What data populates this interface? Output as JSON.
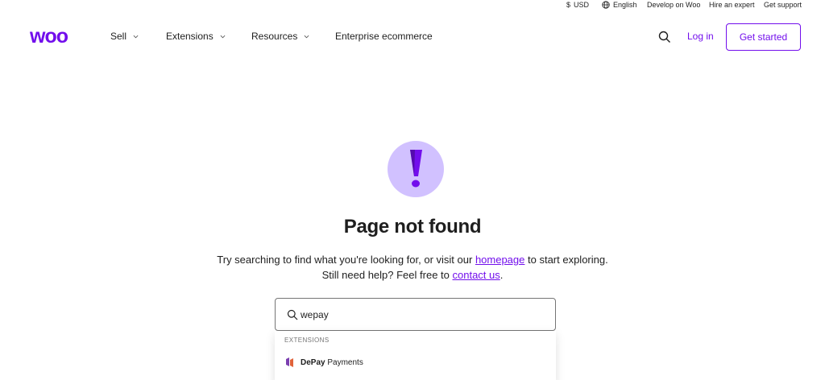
{
  "utility": {
    "currency": "USD",
    "language": "English",
    "develop": "Develop on Woo",
    "hire": "Hire an expert",
    "support": "Get support"
  },
  "header": {
    "logo_text": "woo",
    "nav": {
      "sell": "Sell",
      "extensions": "Extensions",
      "resources": "Resources",
      "enterprise": "Enterprise ecommerce"
    },
    "login": "Log in",
    "get_started": "Get started"
  },
  "content": {
    "title": "Page not found",
    "message_before": "Try searching to find what you're looking for, or visit our ",
    "homepage_link": "homepage",
    "message_middle": " to start exploring. Still need help? Feel free to ",
    "contact_link": "contact us",
    "message_end": "."
  },
  "search": {
    "value": "wepay"
  },
  "dropdown": {
    "section_label": "EXTENSIONS",
    "result_bold": "DePay",
    "result_rest": " Payments"
  },
  "colors": {
    "brand": "#720eec",
    "alert_bg": "#d1c1ff",
    "alert_fg": "#720eec"
  },
  "icons": {
    "currency": "dollar-icon",
    "language": "globe-icon",
    "search": "search-icon",
    "alert": "exclamation-icon"
  }
}
